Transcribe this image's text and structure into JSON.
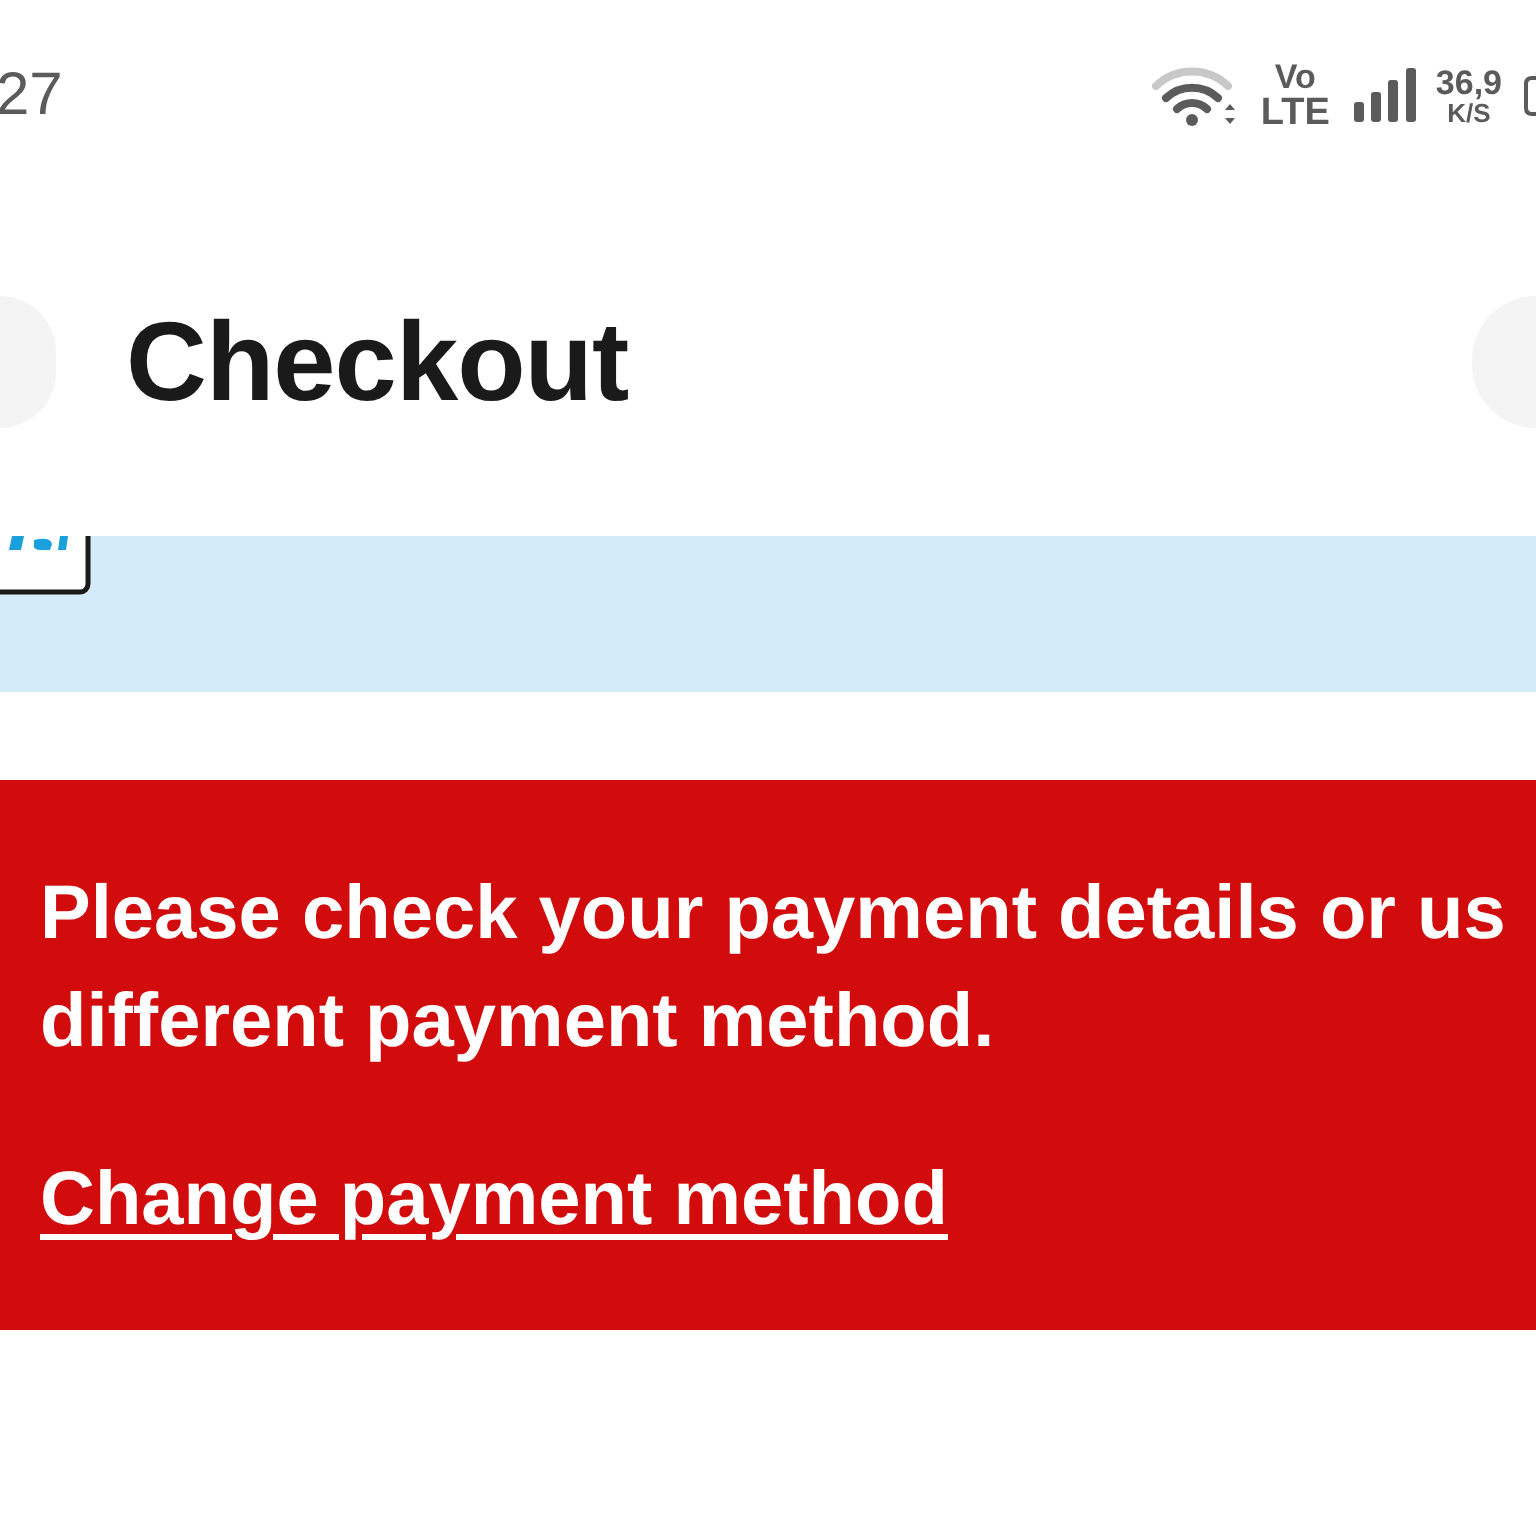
{
  "status_bar": {
    "time": "27",
    "network_label": [
      "Vo",
      "LTE"
    ],
    "speed": "36,9",
    "speed_unit": "K/S"
  },
  "header": {
    "title": "Checkout"
  },
  "error_alert": {
    "message": "Please check your payment details or us\ndifferent payment method.",
    "link": "Change payment method"
  }
}
